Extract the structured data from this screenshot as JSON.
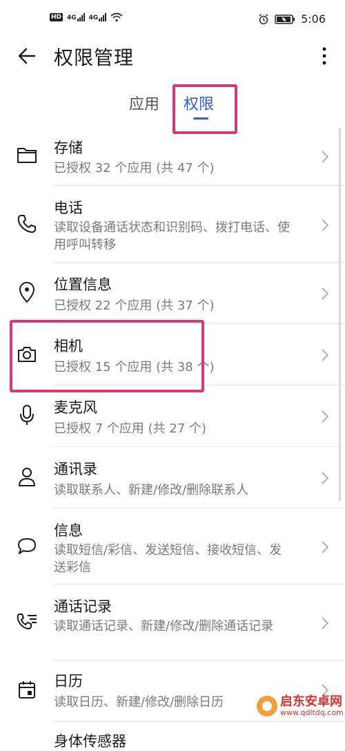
{
  "status_bar": {
    "hd_label": "HD",
    "sim1_label": "4G",
    "sim2_label": "4G",
    "time": "5:06",
    "icons": [
      "alarm-icon",
      "battery-charging-icon",
      "wifi-icon",
      "signal-icon"
    ]
  },
  "header": {
    "title": "权限管理",
    "back_icon": "arrow-left-icon",
    "more_icon": "more-vertical-icon"
  },
  "tabs": [
    {
      "label": "应用",
      "selected": false
    },
    {
      "label": "权限",
      "selected": true
    }
  ],
  "accent_color": "#2d5fc4",
  "highlight_color": "#d6397a",
  "permissions": [
    {
      "name": "存储",
      "desc": "已授权 32 个应用 (共 47 个)",
      "icon": "folder-icon"
    },
    {
      "name": "电话",
      "desc": "读取设备通话状态和识别码、拨打电话、使用呼叫转移",
      "icon": "phone-icon"
    },
    {
      "name": "位置信息",
      "desc": "已授权 22 个应用 (共 37 个)",
      "icon": "location-pin-icon"
    },
    {
      "name": "相机",
      "desc": "已授权 15 个应用 (共 38 个)",
      "icon": "camera-icon"
    },
    {
      "name": "麦克风",
      "desc": "已授权 7 个应用 (共 27 个)",
      "icon": "microphone-icon"
    },
    {
      "name": "通讯录",
      "desc": "读取联系人、新建/修改/删除联系人",
      "icon": "contact-icon"
    },
    {
      "name": "信息",
      "desc": "读取短信/彩信、发送短信、接收短信、发送彩信",
      "icon": "message-bubble-icon"
    },
    {
      "name": "通话记录",
      "desc": "读取通话记录、新建/修改/删除通话记录",
      "icon": "call-log-icon"
    },
    {
      "name": "日历",
      "desc": "读取日历、新建/修改/删除日历",
      "icon": "calendar-icon"
    },
    {
      "name": "身体传感器",
      "desc": "",
      "icon": "sensor-icon"
    }
  ],
  "watermark": {
    "line1": "启东安卓网",
    "line2": "www.qdltdq.com"
  }
}
